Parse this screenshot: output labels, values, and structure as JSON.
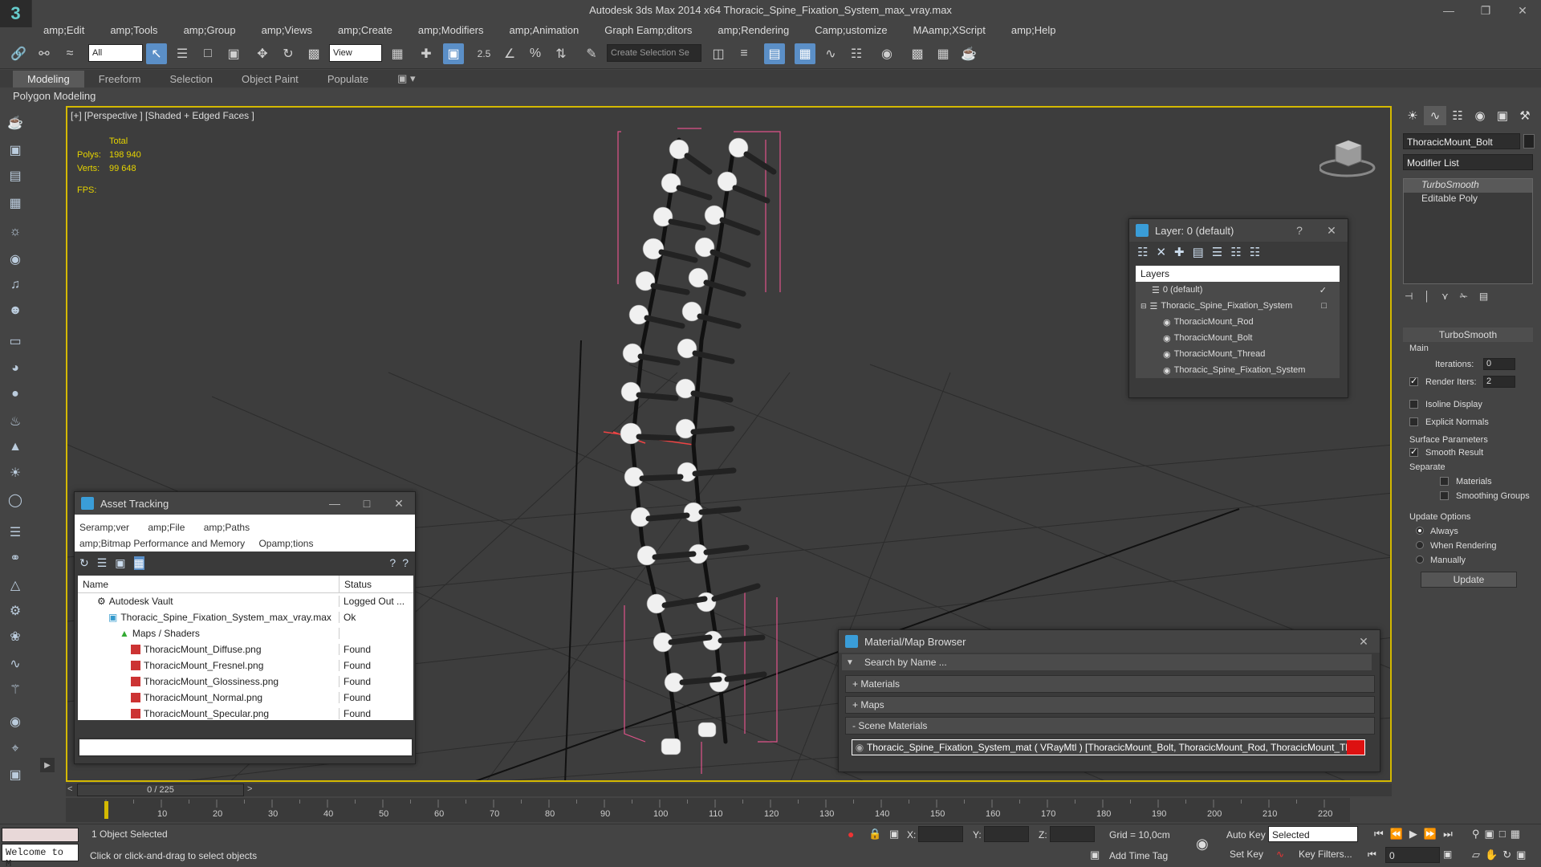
{
  "app": {
    "title": "Autodesk 3ds Max  2014 x64     Thoracic_Spine_Fixation_System_max_vray.max",
    "logo": "3"
  },
  "menu": [
    "amp;Edit",
    "amp;Tools",
    "amp;Group",
    "amp;Views",
    "amp;Create",
    "amp;Modifiers",
    "amp;Animation",
    "Graph Eamp;ditors",
    "amp;Rendering",
    "Camp;ustomize",
    "MAamp;XScript",
    "amp;Help"
  ],
  "toolbar": {
    "selection_filter": "All",
    "ref_coord": "View",
    "named_selection": "Create Selection Se",
    "snap_value": "2.5"
  },
  "ribbon": {
    "tabs": [
      "Modeling",
      "Freeform",
      "Selection",
      "Object Paint",
      "Populate"
    ],
    "active": "Modeling",
    "panel": "Polygon Modeling"
  },
  "viewport": {
    "label": "[+] [Perspective ] [Shaded + Edged Faces ]",
    "stats_header": "Total",
    "polys_label": "Polys:",
    "polys_value": "198 940",
    "verts_label": "Verts:",
    "verts_value": "99 648",
    "fps_label": "FPS:"
  },
  "layer_dialog": {
    "title": "Layer: 0 (default)",
    "help": "?",
    "list_header": "Layers",
    "rows": [
      "0 (default)",
      "Thoracic_Spine_Fixation_System",
      "ThoracicMount_Rod",
      "ThoracicMount_Bolt",
      "ThoracicMount_Thread",
      "Thoracic_Spine_Fixation_System"
    ]
  },
  "asset_tracking": {
    "title": "Asset Tracking",
    "menu_row1": [
      "Seramp;ver",
      "amp;File",
      "amp;Paths"
    ],
    "menu_row2": [
      "amp;Bitmap Performance and Memory",
      "Opamp;tions"
    ],
    "col_name": "Name",
    "col_status": "Status",
    "rows": [
      {
        "name": "Autodesk Vault",
        "status": "Logged Out ..."
      },
      {
        "name": "Thoracic_Spine_Fixation_System_max_vray.max",
        "status": "Ok"
      },
      {
        "name": "Maps / Shaders",
        "status": ""
      },
      {
        "name": "ThoracicMount_Diffuse.png",
        "status": "Found"
      },
      {
        "name": "ThoracicMount_Fresnel.png",
        "status": "Found"
      },
      {
        "name": "ThoracicMount_Glossiness.png",
        "status": "Found"
      },
      {
        "name": "ThoracicMount_Normal.png",
        "status": "Found"
      },
      {
        "name": "ThoracicMount_Specular.png",
        "status": "Found"
      }
    ]
  },
  "material_browser": {
    "title": "Material/Map Browser",
    "search_placeholder": "Search by Name ...",
    "sections": [
      "+ Materials",
      "+ Maps",
      "- Scene Materials"
    ],
    "scene_material": "Thoracic_Spine_Fixation_System_mat  ( VRayMtl ) [ThoracicMount_Bolt, ThoracicMount_Rod, ThoracicMount_Thread]"
  },
  "command_panel": {
    "object_name": "ThoracicMount_Bolt",
    "modifier_list": "Modifier List",
    "stack": [
      "TurboSmooth",
      "Editable Poly"
    ],
    "rollout": "TurboSmooth",
    "main_label": "Main",
    "iterations_label": "Iterations:",
    "iterations_value": "0",
    "render_iters_label": "Render Iters:",
    "render_iters_value": "2",
    "isoline_label": "Isoline Display",
    "explicit_label": "Explicit Normals",
    "surface_label": "Surface Parameters",
    "smooth_label": "Smooth Result",
    "separate_label": "Separate",
    "materials_label": "Materials",
    "smoothing_label": "Smoothing Groups",
    "update_label": "Update Options",
    "always_label": "Always",
    "when_label": "When Rendering",
    "manually_label": "Manually",
    "update_button": "Update"
  },
  "timeline": {
    "frame": "0 / 225",
    "ticks": [
      "10",
      "20",
      "30",
      "40",
      "50",
      "60",
      "70",
      "80",
      "90",
      "100",
      "110",
      "120",
      "130",
      "140",
      "150",
      "160",
      "170",
      "180",
      "190",
      "200",
      "210",
      "220"
    ]
  },
  "status": {
    "welcome": "Welcome to M",
    "selected": "1 Object Selected",
    "prompt": "Click or click-and-drag to select objects",
    "x_label": "X:",
    "y_label": "Y:",
    "z_label": "Z:",
    "grid": "Grid = 10,0cm",
    "add_time_tag": "Add Time Tag",
    "auto_key": "Auto Key",
    "set_key": "Set Key",
    "key_mode": "Selected",
    "key_filters": "Key Filters...",
    "frame_value": "0"
  }
}
